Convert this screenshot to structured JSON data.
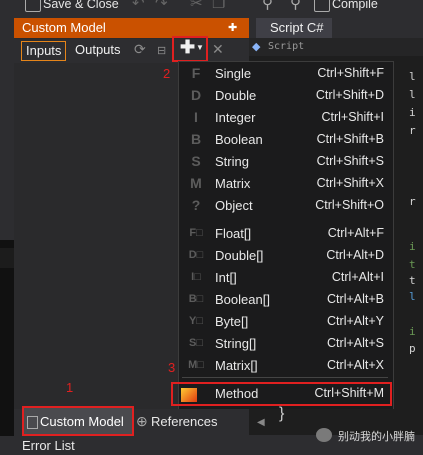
{
  "toolbar": {
    "save_close_label": "Save & Close",
    "compile_label": "Compile"
  },
  "panel": {
    "title": "Custom Model",
    "tabs": [
      "Inputs",
      "Outputs"
    ]
  },
  "script": {
    "tab_label": "Script C#",
    "file_title": "Script"
  },
  "markers": [
    "1",
    "2",
    "3"
  ],
  "menu": {
    "items": [
      {
        "icon": "F",
        "label": "Single",
        "shortcut": "Ctrl+Shift+F"
      },
      {
        "icon": "D",
        "label": "Double",
        "shortcut": "Ctrl+Shift+D"
      },
      {
        "icon": "I",
        "label": "Integer",
        "shortcut": "Ctrl+Shift+I"
      },
      {
        "icon": "B",
        "label": "Boolean",
        "shortcut": "Ctrl+Shift+B"
      },
      {
        "icon": "S",
        "label": "String",
        "shortcut": "Ctrl+Shift+S"
      },
      {
        "icon": "M",
        "label": "Matrix",
        "shortcut": "Ctrl+Shift+X"
      },
      {
        "icon": "?",
        "label": "Object",
        "shortcut": "Ctrl+Shift+O"
      },
      {
        "icon": "F□",
        "label": "Float[]",
        "shortcut": "Ctrl+Alt+F"
      },
      {
        "icon": "D□",
        "label": "Double[]",
        "shortcut": "Ctrl+Alt+D"
      },
      {
        "icon": "I□",
        "label": "Int[]",
        "shortcut": "Ctrl+Alt+I"
      },
      {
        "icon": "B□",
        "label": "Boolean[]",
        "shortcut": "Ctrl+Alt+B"
      },
      {
        "icon": "Y□",
        "label": "Byte[]",
        "shortcut": "Ctrl+Alt+Y"
      },
      {
        "icon": "S□",
        "label": "String[]",
        "shortcut": "Ctrl+Alt+S"
      },
      {
        "icon": "M□",
        "label": "Matrix[]",
        "shortcut": "Ctrl+Alt+X"
      }
    ],
    "method": {
      "label": "Method",
      "shortcut": "Ctrl+Shift+M"
    }
  },
  "bottom_tabs": {
    "custom_model": "Custom Model",
    "references": "References"
  },
  "status": {
    "label": "Error List"
  },
  "watermark": "别动我的小胖腩",
  "colors": {
    "accent": "#ca5100",
    "highlight_box": "#e02020"
  }
}
